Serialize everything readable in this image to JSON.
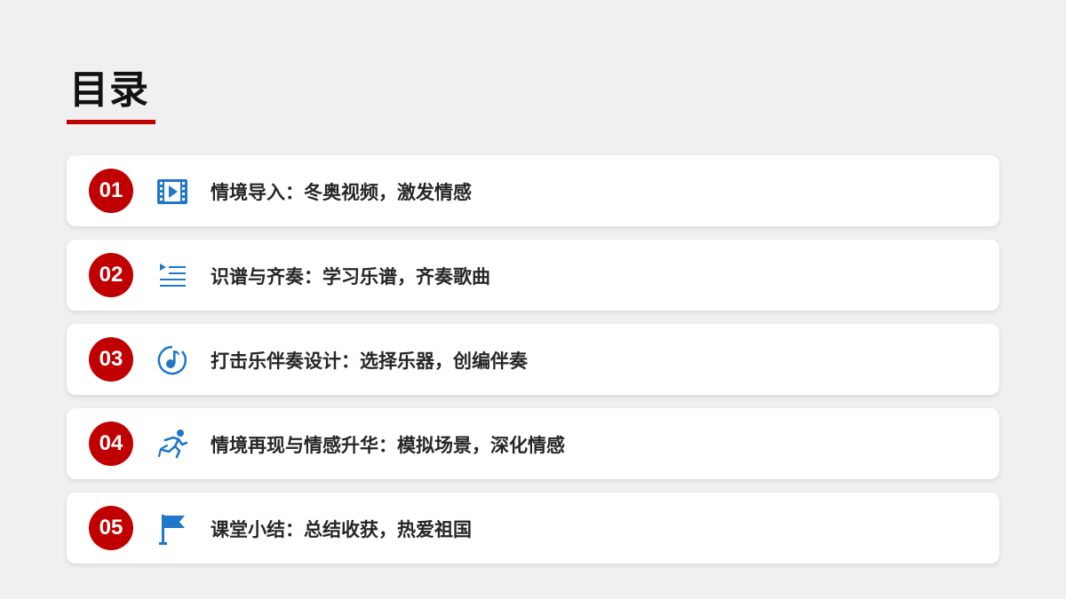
{
  "page": {
    "title": "目录"
  },
  "colors": {
    "accent": "#c00000",
    "icon": "#1f77c9",
    "background": "#f0f0f0",
    "card": "#ffffff"
  },
  "toc": {
    "items": [
      {
        "number": "01",
        "icon": "video-film-icon",
        "text": "情境导入：冬奥视频，激发情感"
      },
      {
        "number": "02",
        "icon": "playlist-icon",
        "text": "识谱与齐奏：学习乐谱，齐奏歌曲"
      },
      {
        "number": "03",
        "icon": "music-note-icon",
        "text": "打击乐伴奏设计：选择乐器，创编伴奏"
      },
      {
        "number": "04",
        "icon": "running-person-icon",
        "text": "情境再现与情感升华：模拟场景，深化情感"
      },
      {
        "number": "05",
        "icon": "flag-icon",
        "text": "课堂小结：总结收获，热爱祖国"
      }
    ]
  }
}
